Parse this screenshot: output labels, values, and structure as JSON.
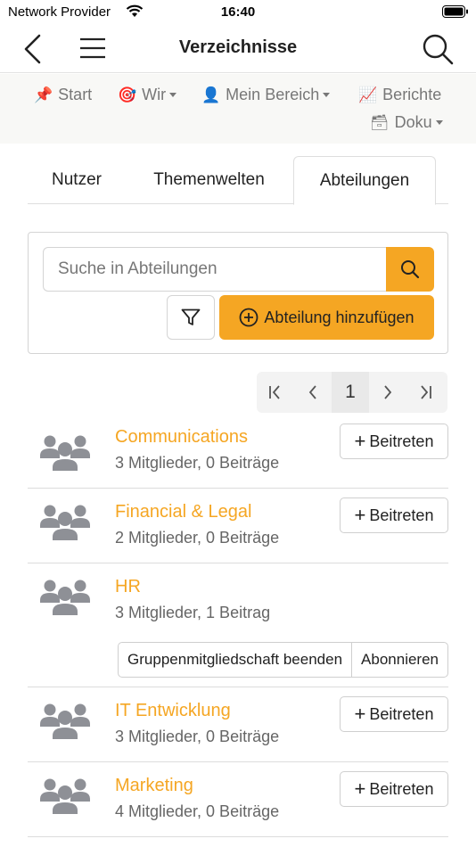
{
  "status_bar": {
    "carrier": "Network Provider",
    "time": "16:40"
  },
  "nav": {
    "title": "Verzeichnisse",
    "icons": [
      "back-icon",
      "hamburger-menu-icon",
      "search-icon"
    ]
  },
  "menu": {
    "items": [
      {
        "label": "Start",
        "emoji": "📌",
        "dropdown": false
      },
      {
        "label": "Wir",
        "emoji": "🎯",
        "dropdown": true
      },
      {
        "label": "Mein Bereich",
        "emoji": "👤",
        "dropdown": true
      },
      {
        "label": "Berichte",
        "emoji": "📈",
        "dropdown": false
      },
      {
        "label": "Doku",
        "emoji": "🗃",
        "dropdown": true
      }
    ]
  },
  "tabs": [
    {
      "label": "Nutzer",
      "active": false
    },
    {
      "label": "Themenwelten",
      "active": false
    },
    {
      "label": "Abteilungen",
      "active": true
    }
  ],
  "search": {
    "placeholder": "Suche in Abteilungen",
    "add_label": "Abteilung hinzufügen"
  },
  "pagination": {
    "current_page": "1"
  },
  "departments": [
    {
      "name": "Communications",
      "meta": "3 Mitglieder, 0 Beiträge",
      "action": "Beitreten"
    },
    {
      "name": "Financial & Legal",
      "meta": "2 Mitglieder, 0 Beiträge",
      "action": "Beitreten"
    },
    {
      "name": "HR",
      "meta": "3 Mitglieder, 1 Beitrag",
      "leave_label": "Gruppenmitgliedschaft beenden",
      "subscribe_label": "Abonnieren"
    },
    {
      "name": "IT Entwicklung",
      "meta": "3 Mitglieder, 0 Beiträge",
      "action": "Beitreten"
    },
    {
      "name": "Marketing",
      "meta": "4 Mitglieder, 0 Beiträge",
      "action": "Beitreten"
    }
  ],
  "colors": {
    "accent": "#f5a623",
    "link": "#f5a623",
    "muted": "#777777"
  }
}
